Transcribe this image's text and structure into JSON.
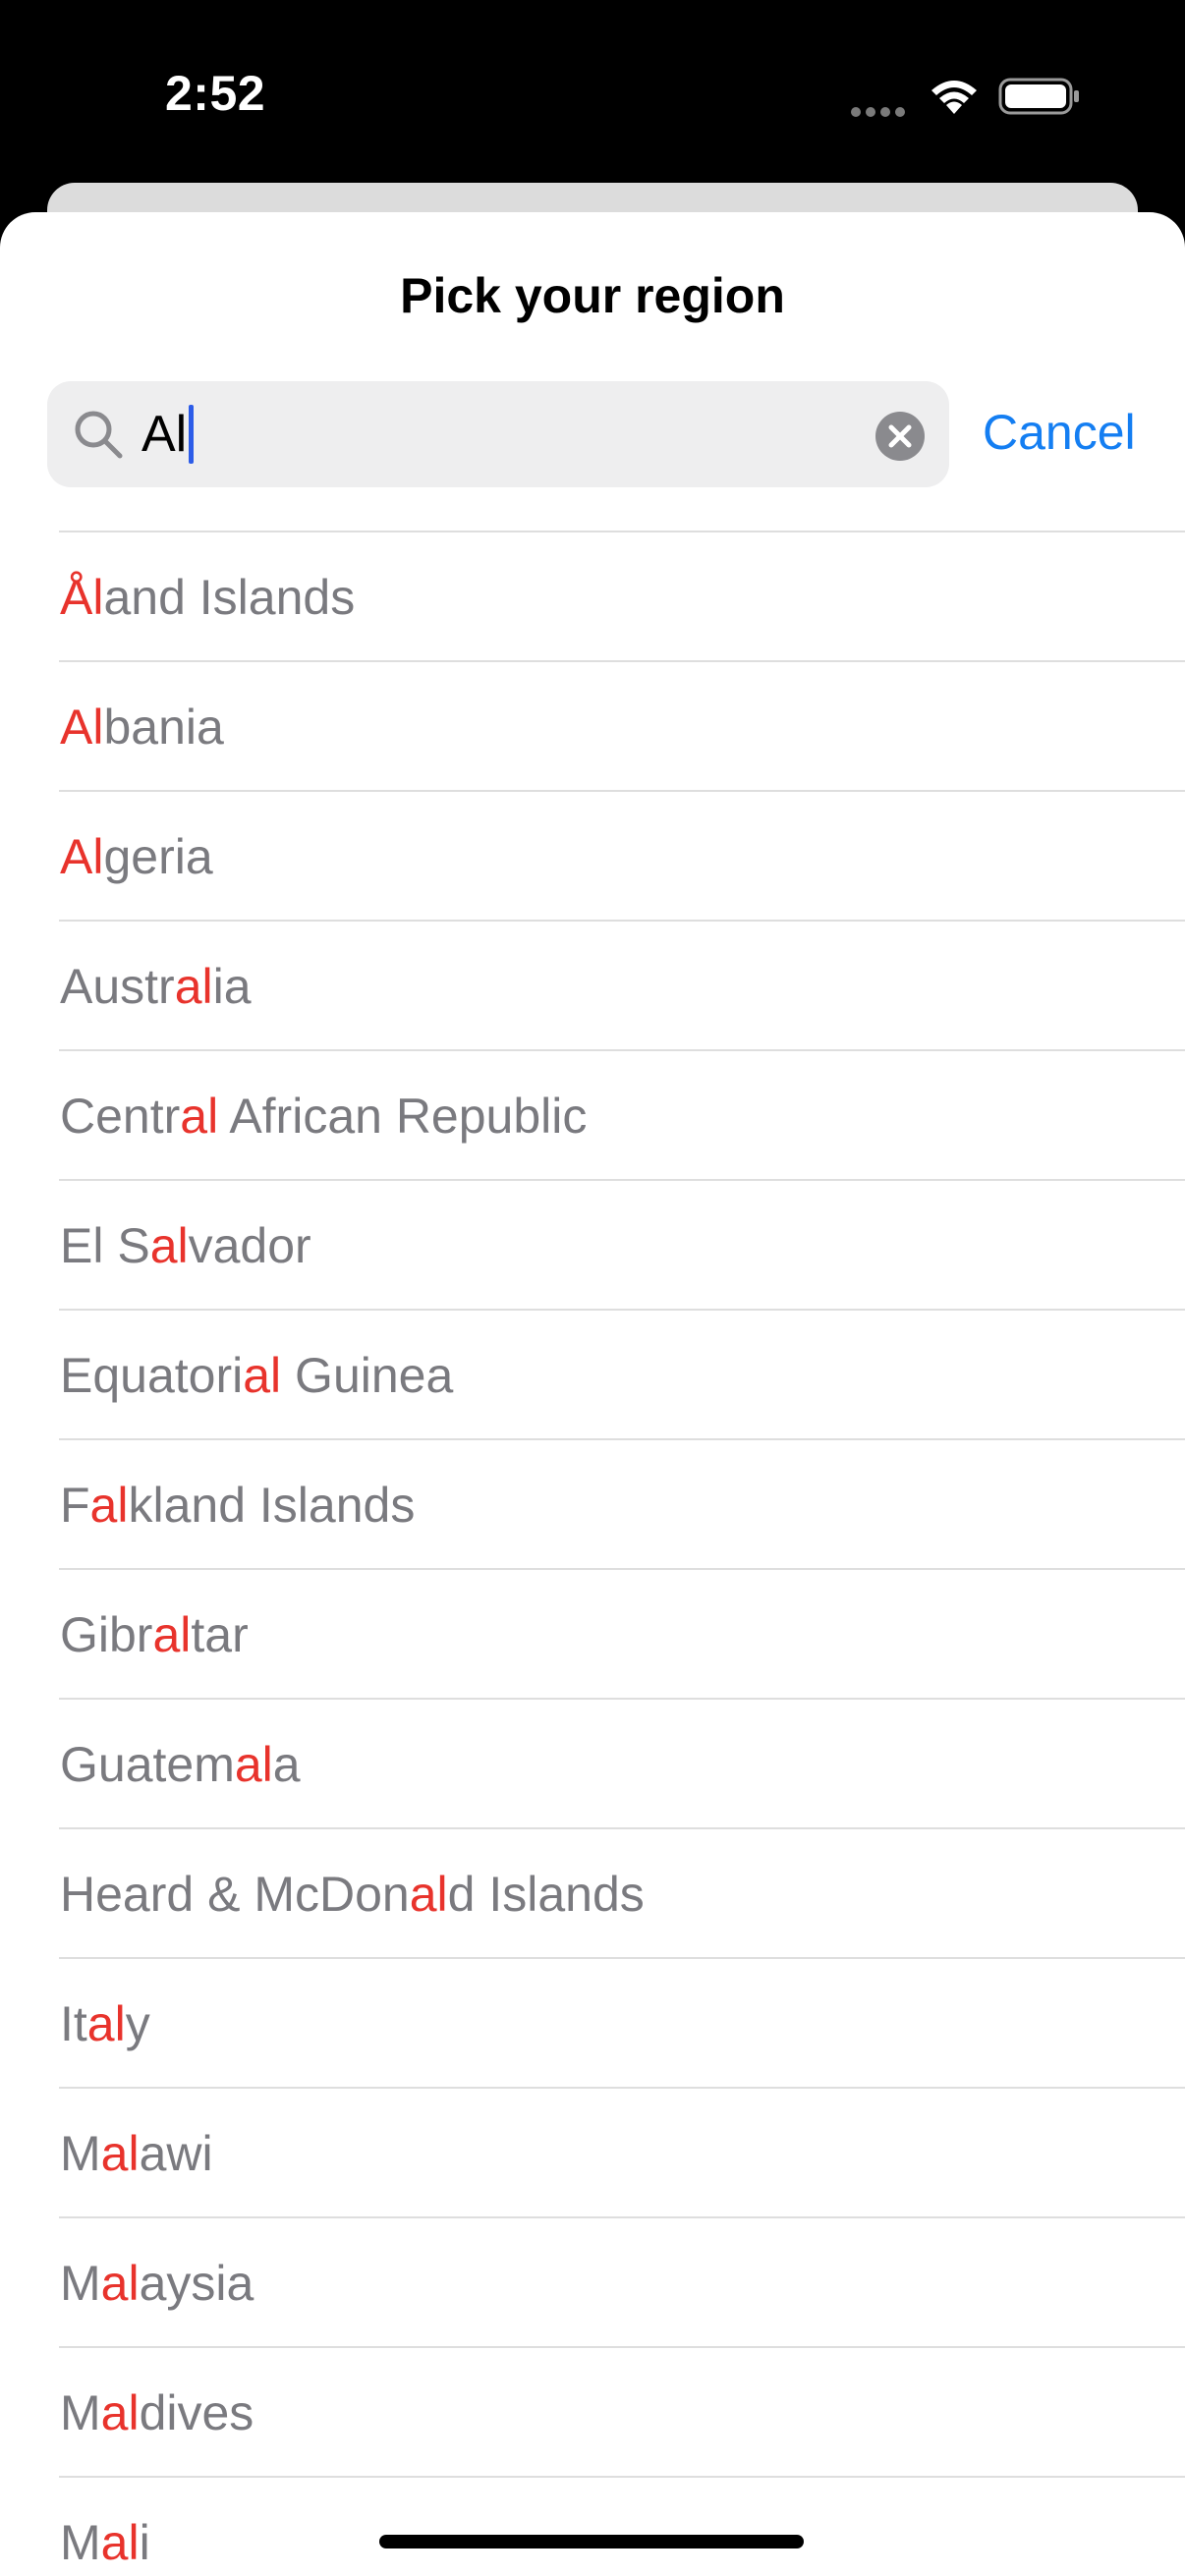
{
  "status_bar": {
    "time": "2:52"
  },
  "sheet": {
    "title": "Pick your region"
  },
  "search": {
    "value": "Al",
    "cancel_label": "Cancel"
  },
  "regions": [
    {
      "pre": "",
      "match": "Ål",
      "post": "and Islands"
    },
    {
      "pre": "",
      "match": "Al",
      "post": "bania"
    },
    {
      "pre": "",
      "match": "Al",
      "post": "geria"
    },
    {
      "pre": "Austr",
      "match": "al",
      "post": "ia"
    },
    {
      "pre": "Centr",
      "match": "al",
      "post": " African Republic"
    },
    {
      "pre": "El S",
      "match": "al",
      "post": "vador"
    },
    {
      "pre": "Equatori",
      "match": "al",
      "post": " Guinea"
    },
    {
      "pre": "F",
      "match": "al",
      "post": "kland Islands"
    },
    {
      "pre": "Gibr",
      "match": "al",
      "post": "tar"
    },
    {
      "pre": "Guatem",
      "match": "al",
      "post": "a"
    },
    {
      "pre": "Heard & McDon",
      "match": "al",
      "post": "d Islands"
    },
    {
      "pre": "It",
      "match": "al",
      "post": "y"
    },
    {
      "pre": "M",
      "match": "al",
      "post": "awi"
    },
    {
      "pre": "M",
      "match": "al",
      "post": "aysia"
    },
    {
      "pre": "M",
      "match": "al",
      "post": "dives"
    },
    {
      "pre": "M",
      "match": "al",
      "post": "i"
    }
  ],
  "colors": {
    "accent": "#147ef2",
    "match_highlight": "#e8332c",
    "text_secondary": "#7a7a7f"
  }
}
